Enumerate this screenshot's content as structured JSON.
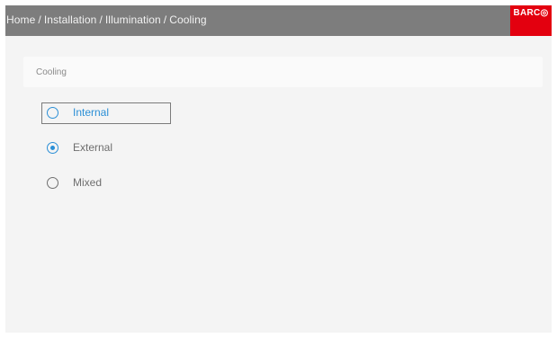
{
  "header": {
    "breadcrumb": [
      "Home",
      "Installation",
      "Illumination",
      "Cooling"
    ],
    "separator": "/",
    "logo_text": "BARC◎",
    "background_color": "#7d7d7d"
  },
  "section": {
    "title": "Cooling"
  },
  "cooling_options": [
    {
      "label": "Internal",
      "selected": false,
      "focused": true
    },
    {
      "label": "External",
      "selected": true,
      "focused": false
    },
    {
      "label": "Mixed",
      "selected": false,
      "focused": false
    }
  ],
  "colors": {
    "accent": "#2b8fd6",
    "brand": "#e3000f",
    "text": "#6e6e6e"
  }
}
